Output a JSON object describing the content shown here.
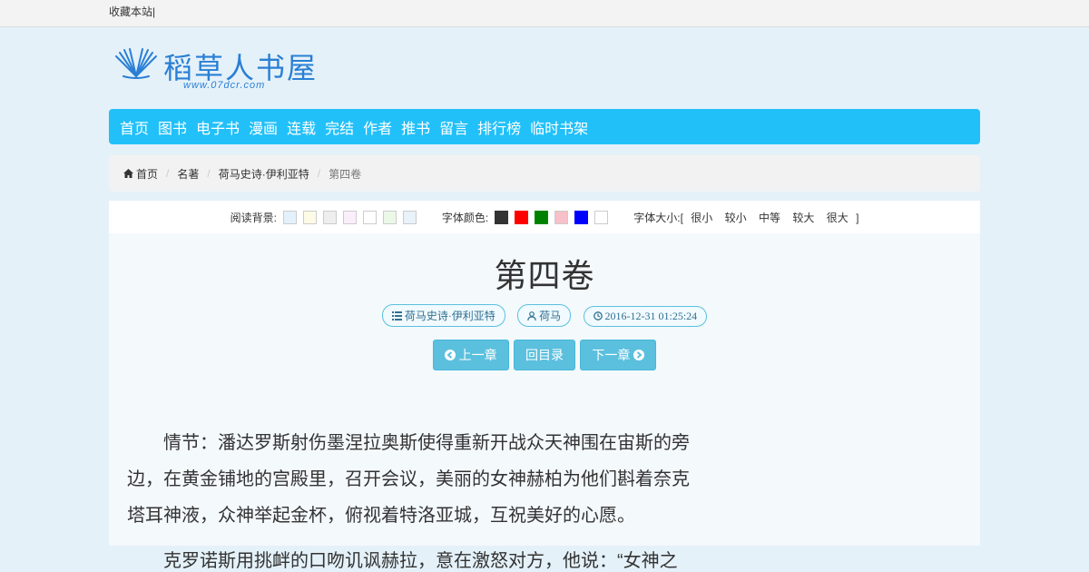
{
  "topbar": {
    "bookmark": "收藏本站|"
  },
  "logo": {
    "brand": "稻草人书屋",
    "url": "www.07dcr.com"
  },
  "nav": [
    "首页",
    "图书",
    "电子书",
    "漫画",
    "连载",
    "完结",
    "作者",
    "推书",
    "留言",
    "排行榜",
    "临时书架"
  ],
  "breadcrumb": {
    "home": "首页",
    "category": "名著",
    "book": "荷马史诗·伊利亚特",
    "current": "第四卷"
  },
  "tools": {
    "bg_label": "阅读背景:",
    "bg_colors": [
      "#e3f1fd",
      "#fdfbe6",
      "#eeeeee",
      "#fbeefb",
      "#ffffff",
      "#ebf8e8",
      "#e9f1f9"
    ],
    "font_color_label": "字体颜色:",
    "font_colors": [
      "#333333",
      "#ff0000",
      "#008000",
      "#f8c0c8",
      "#0000ff",
      "#ffffff"
    ],
    "font_size_label": "字体大小:[",
    "sizes": [
      "很小",
      "较小",
      "中等",
      "较大",
      "很大"
    ],
    "font_size_close": "]"
  },
  "chapter": {
    "title": "第四卷",
    "book": "荷马史诗·伊利亚特",
    "author": "荷马",
    "time": "2016-12-31 01:25:24"
  },
  "buttons": {
    "prev": "上一章",
    "toc": "回目录",
    "next": "下一章"
  },
  "content": {
    "p1": "情节：潘达罗斯射伤墨涅拉奥斯使得重新开战众天神围在宙斯的旁边，在黄金铺地的宫殿里，召开会议，美丽的女神赫柏为他们斟着奈克塔耳神液，众神举起金杯，俯视着特洛亚城，互祝美好的心愿。",
    "p2": "克罗诺斯用挑衅的口吻讥讽赫拉，意在激怒对方，他说：“女神之"
  },
  "colors": {
    "nav": "#22c0f9",
    "button": "#5bc0de",
    "brand": "#2a7fd4"
  }
}
